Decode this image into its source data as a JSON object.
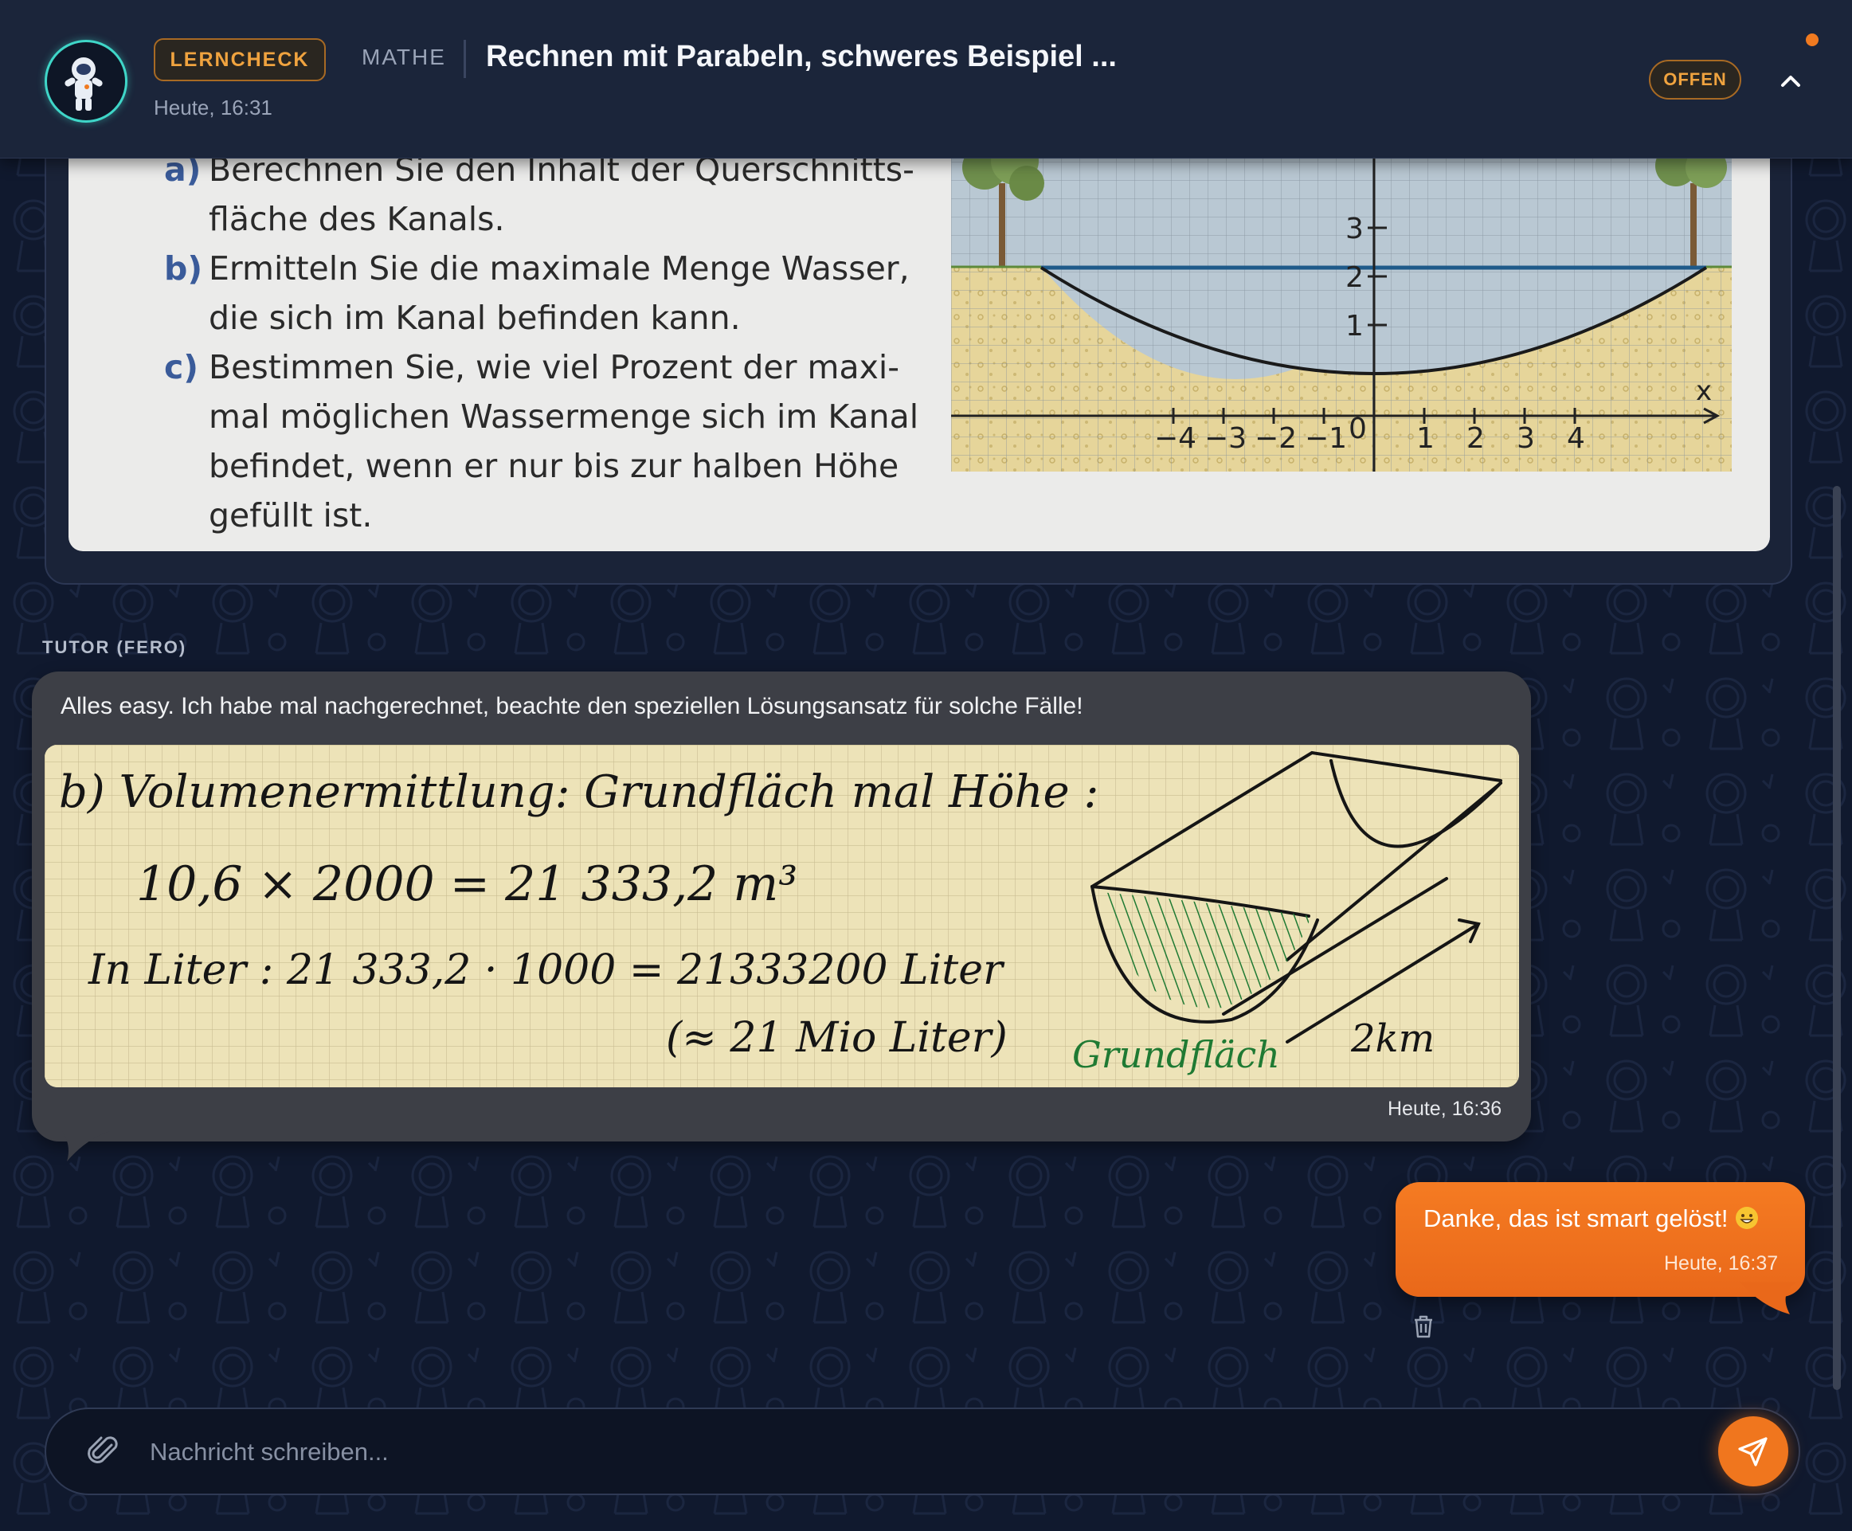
{
  "header": {
    "badge": "LERNCHECK",
    "subject": "MATHE",
    "title": "Rechnen mit Parabeln, schweres Beispiel ...",
    "timestamp": "Heute, 16:31",
    "status": "OFFEN",
    "icons": [
      "astronaut-avatar-icon",
      "chevron-up-icon"
    ],
    "accent_color": "#f0a33f"
  },
  "task_image": {
    "lines": [
      {
        "label": "a)",
        "text": "Berechnen Sie den Inhalt der Querschnitts-"
      },
      {
        "label": "",
        "text": "fläche des Kanals."
      },
      {
        "label": "b)",
        "text": "Ermitteln Sie die maximale Menge Wasser,"
      },
      {
        "label": "",
        "text": "die sich im Kanal befinden kann."
      },
      {
        "label": "c)",
        "text": "Bestimmen Sie, wie viel Prozent der maxi-"
      },
      {
        "label": "",
        "text": "mal möglichen Wassermenge sich im Kanal"
      },
      {
        "label": "",
        "text": "befindet, wenn er nur bis zur halben Höhe"
      },
      {
        "label": "",
        "text": "gefüllt ist."
      }
    ],
    "graph": {
      "x_axis_label": "x",
      "x_ticks": [
        "-4",
        "-3",
        "-2",
        "-1",
        "0",
        "1",
        "2",
        "3",
        "4"
      ],
      "y_ticks": [
        "1",
        "2",
        "3"
      ]
    }
  },
  "tutor": {
    "label": "TUTOR (FERO)",
    "message": "Alles easy. Ich habe mal nachgerechnet, beachte den speziellen Lösungsansatz für solche Fälle!",
    "timestamp": "Heute, 16:36",
    "notes": {
      "line1": "b) Volumenermittlung: Grundfläch mal Höhe :",
      "line2": "10,6 × 2000 = 21 333,2 m³",
      "line3": "In Liter : 21 333,2 · 1000 = 21333200 Liter",
      "line4": "(≈ 21 Mio Liter)",
      "label_area": "Grundfläch",
      "label_length": "2km"
    }
  },
  "user": {
    "message": "Danke, das ist smart gelöst!",
    "timestamp": "Heute, 16:37",
    "bubble_color": "#f07a20"
  },
  "composer": {
    "placeholder": "Nachricht schreiben...",
    "icons": [
      "paperclip-icon",
      "send-icon",
      "trash-icon"
    ]
  }
}
